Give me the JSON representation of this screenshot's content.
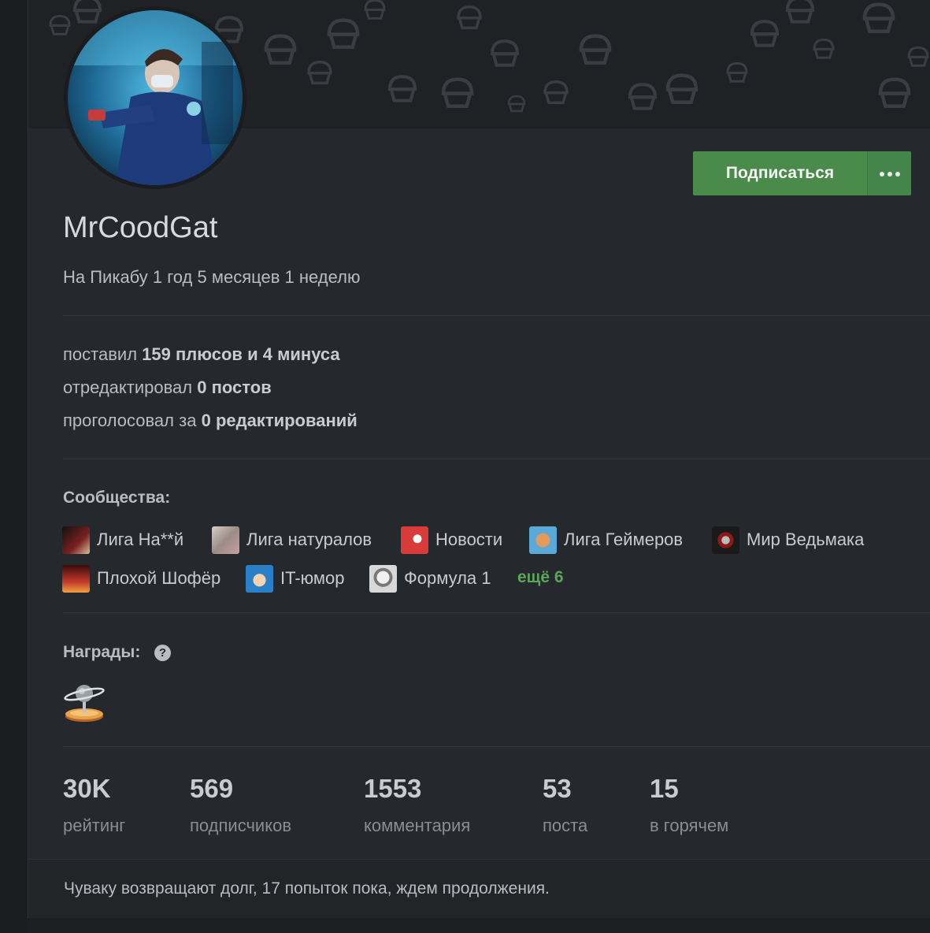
{
  "profile": {
    "username": "MrCoodGat",
    "since": "На Пикабу 1 год 5 месяцев 1 неделю",
    "avatar_icon": "avatar-image"
  },
  "actions": {
    "subscribe_label": "Подписаться",
    "more_icon": "more-dots-icon"
  },
  "activity": {
    "line1_prefix": "поставил",
    "plus_count": "159",
    "plus_word": "плюсов и",
    "minus_count": "4",
    "minus_word": "минуса",
    "line2_prefix": "отредактировал",
    "edited_count": "0",
    "edited_word": "постов",
    "line3_prefix": "проголосовал за",
    "voted_count": "0",
    "voted_word": "редактирований"
  },
  "communities": {
    "title": "Сообщества:",
    "items": [
      {
        "label": "Лига На**й",
        "color": "#7a2020"
      },
      {
        "label": "Лига натуралов",
        "color": "#9c8b86"
      },
      {
        "label": "Новости",
        "color": "#d93b3b"
      },
      {
        "label": "Лига Геймеров",
        "color": "#5aa9d8"
      },
      {
        "label": "Мир Ведьмака",
        "color": "#3a2a2a"
      },
      {
        "label": "Плохой Шофёр",
        "color": "#c0392b"
      },
      {
        "label": "IT-юмор",
        "color": "#2a7fc9"
      },
      {
        "label": "Формула 1",
        "color": "#d8d8d8"
      }
    ],
    "more_label": "ещё 6"
  },
  "awards": {
    "title": "Награды:",
    "help_icon": "question-circle-icon",
    "award_icon": "saturn-trophy-icon"
  },
  "stats": [
    {
      "value": "30K",
      "label": "рейтинг"
    },
    {
      "value": "569",
      "label": "подписчиков"
    },
    {
      "value": "1553",
      "label": "комментария"
    },
    {
      "value": "53",
      "label": "поста"
    },
    {
      "value": "15",
      "label": "в горячем"
    }
  ],
  "footer": {
    "text": "Чуваку возвращают долг, 17 попыток пока, ждем продолжения."
  },
  "colors": {
    "accent_green": "#4a8b4c",
    "plus_green": "#5ba65c",
    "minus_red": "#e0393d",
    "card_bg": "#25282c"
  }
}
